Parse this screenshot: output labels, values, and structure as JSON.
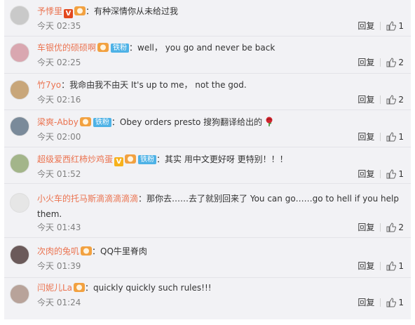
{
  "comments": [
    {
      "name": "予悸里",
      "badges": [
        "v-red",
        "lv"
      ],
      "fan": "",
      "text": "：有种深情你从未给过我",
      "time": "今天 02:35",
      "reply": "回复",
      "likes": "1",
      "avatar_color": "#c9c9c9",
      "avatar_icon": "avatar-icon"
    },
    {
      "name": "车银优的硕硕啊",
      "badges": [
        "lv"
      ],
      "fan": "铁粉",
      "text": "：well， you go and never be back",
      "time": "今天 02:25",
      "reply": "回复",
      "likes": "2",
      "avatar_color": "#d9a7b0",
      "avatar_icon": "avatar-icon"
    },
    {
      "name": "竹7yo",
      "badges": [],
      "fan": "",
      "text": "：我命由我不由天 It's up to me， not the god.",
      "time": "今天 02:16",
      "reply": "回复",
      "likes": "2",
      "avatar_color": "#c8a67a",
      "avatar_icon": "avatar-icon"
    },
    {
      "name": "梁爽-Abby",
      "badges": [
        "lv"
      ],
      "fan": "铁粉",
      "text": "：Obey orders presto  搜狗翻译给出的",
      "time": "今天 02:00",
      "reply": "回复",
      "likes": "1",
      "avatar_color": "#7a8a9a",
      "avatar_icon": "avatar-icon",
      "rose": true
    },
    {
      "name": "超级爱西红柿炒鸡蛋",
      "badges": [
        "v-gold",
        "lv"
      ],
      "fan": "铁粉",
      "text": "：其实 用中文更好呀 更特别！！！",
      "time": "今天 01:52",
      "reply": "回复",
      "likes": "1",
      "avatar_color": "#a3b58a",
      "avatar_icon": "avatar-icon"
    },
    {
      "name": "小火车的托马斯滴滴滴滴滴",
      "badges": [],
      "fan": "",
      "text": "：那你去……去了就别回来了 You can go……go to hell if you help them.",
      "time": "今天 01:43",
      "reply": "回复",
      "likes": "2",
      "avatar_color": "#e6e6e6",
      "avatar_icon": "avatar-icon"
    },
    {
      "name": "次肉的兔叽",
      "badges": [
        "lv"
      ],
      "fan": "",
      "text": "：QQ牛里脊肉",
      "time": "今天 01:39",
      "reply": "回复",
      "likes": "1",
      "avatar_color": "#6b5a5a",
      "avatar_icon": "avatar-icon"
    },
    {
      "name": "闫妮儿La",
      "badges": [
        "lv"
      ],
      "fan": "",
      "text": "：quickly quickly such rules!!!",
      "time": "今天 01:24",
      "reply": "回复",
      "likes": "1",
      "avatar_color": "#b8a39a",
      "avatar_icon": "avatar-icon"
    }
  ],
  "colors": {
    "name": "#eb7350",
    "fan_badge": "#4eb2e6",
    "time": "#808080",
    "background": "#f2f2f5"
  }
}
